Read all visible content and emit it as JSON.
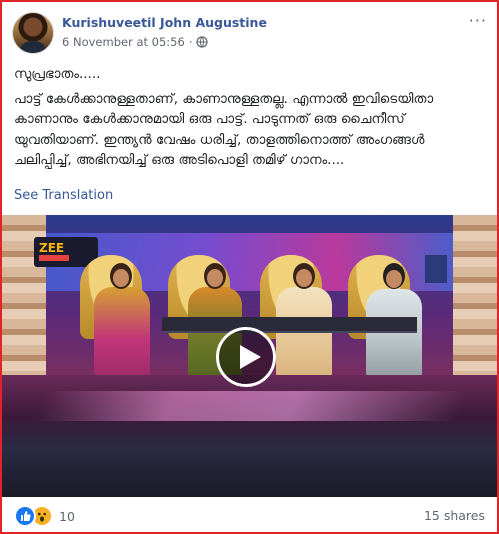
{
  "post": {
    "author": "Kurishuveetil John Augustine",
    "timestamp": "6 November at 05:56",
    "privacy_icon": "globe-icon",
    "text": {
      "greeting": "സുപ്രഭാതം.....",
      "body": "പാട്ട് കേൾക്കാനുള്ളതാണ്, കാണാനുള്ളതല്ല. എന്നാൽ ഇവിടെയിതാ കാണാനും കേൾക്കാനുമായി ഒരു പാട്ട്. പാടുന്നത് ഒരു ചൈനീസ് യുവതിയാണ്. ഇന്ത്യൻ വേഷം ധരിച്ച്, താളത്തിനൊത്ത് അംഗങ്ങൾ ചലിപ്പിച്ച്, അഭിനയിച്ച് ഒരു അടിപൊളി തമിഴ് ഗാനം...."
    },
    "see_translation": "See Translation",
    "video": {
      "channel_logo_text": "ZEE",
      "play_icon": "play-icon"
    },
    "footer": {
      "reaction_icons": [
        "like-icon",
        "wow-icon"
      ],
      "reaction_count": "10",
      "shares": "15 shares"
    }
  },
  "colors": {
    "link_blue": "#385898",
    "border_red": "#e0242a",
    "like_blue": "#1877f2",
    "wow_yellow": "#f7b125"
  }
}
